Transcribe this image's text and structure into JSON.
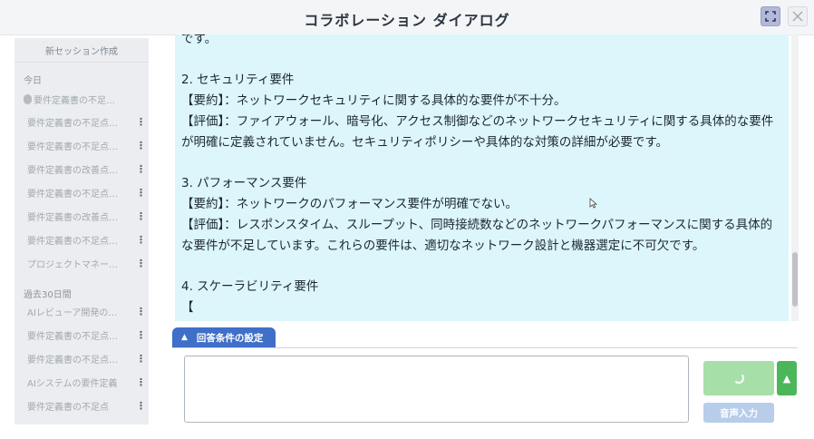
{
  "window": {
    "title": "コラボレーション ダイアログ",
    "maximize_icon": "expand-icon",
    "close_icon": "close-icon"
  },
  "sidebar": {
    "new_session": "新セッション作成",
    "today_label": "今日",
    "today_items": [
      {
        "label": "要件定義書の不足…",
        "active": true
      },
      {
        "label": "要件定義書の不足点…"
      },
      {
        "label": "要件定義書の不足点…"
      },
      {
        "label": "要件定義書の改善点…"
      },
      {
        "label": "要件定義書の不足点…"
      },
      {
        "label": "要件定義書の改善点…"
      },
      {
        "label": "要件定義書の不足点…"
      },
      {
        "label": "プロジェクトマネー…"
      }
    ],
    "past_label": "過去30日間",
    "past_items": [
      {
        "label": "AIレビューア開発の…"
      },
      {
        "label": "要件定義書の不足点…"
      },
      {
        "label": "要件定義書の不足点…"
      },
      {
        "label": "AIシステムの要件定義"
      },
      {
        "label": "要件定義書の不足点"
      }
    ],
    "menu_glyph": "⋮"
  },
  "content": {
    "top_fragment": "です。",
    "sec2_title": "2. セキュリティ要件",
    "sec2_summary": "【要約】：ネットワークセキュリティに関する具体的な要件が不十分。",
    "sec2_eval": "【評価】：ファイアウォール、暗号化、アクセス制御などのネットワークセキュリティに関する具体的な要件が明確に定義されていません。セキュリティポリシーや具体的な対策の詳細が必要です。",
    "sec3_title": "3. パフォーマンス要件",
    "sec3_summary": "【要約】：ネットワークのパフォーマンス要件が明確でない。",
    "sec3_eval": "【評価】：レスポンスタイム、スループット、同時接続数などのネットワークパフォーマンスに関する具体的な要件が不足しています。これらの要件は、適切なネットワーク設計と機器選定に不可欠です。",
    "sec4_title": "4. スケーラビリティ要件",
    "sec4_next": "【"
  },
  "settings_tab": {
    "label": "回答条件の設定",
    "icon": "triangle-up-icon"
  },
  "input": {
    "value": "",
    "placeholder": ""
  },
  "buttons": {
    "send_icon": "loading-spinner-icon",
    "expand_glyph": "▲",
    "voice_label": "音声入力"
  },
  "colors": {
    "content_bg": "#dcf6fb",
    "tab_bg": "#3f6fc8",
    "send_bg": "#a7dfa9",
    "up_bg": "#4cb75a",
    "voice_bg": "#b7cdea"
  }
}
